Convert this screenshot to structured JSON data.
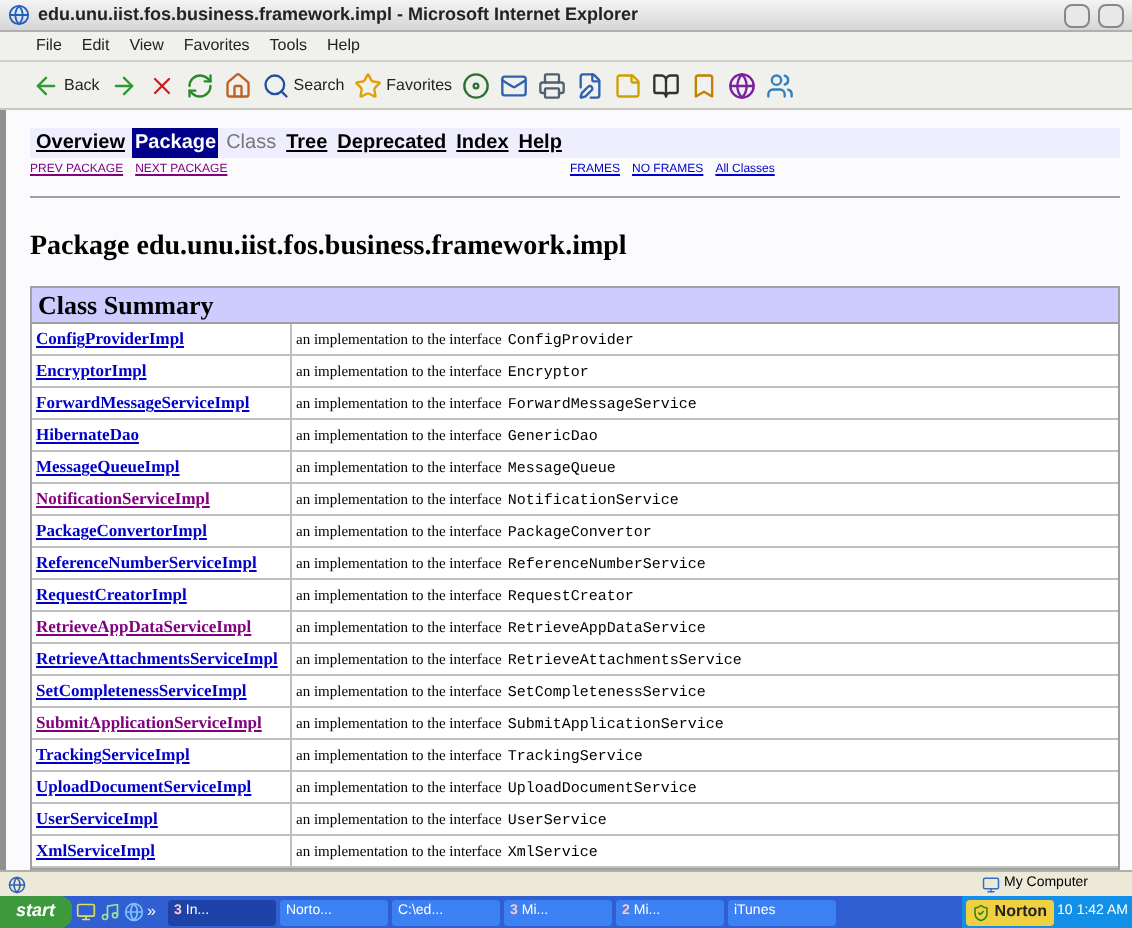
{
  "window": {
    "title": "edu.unu.iist.fos.business.framework.impl - Microsoft Internet Explorer"
  },
  "menu_bar": [
    "File",
    "Edit",
    "View",
    "Favorites",
    "Tools",
    "Help"
  ],
  "toolbar": [
    {
      "kind": "back",
      "label": "Back"
    },
    {
      "kind": "forward"
    },
    {
      "kind": "stop"
    },
    {
      "kind": "refresh"
    },
    {
      "kind": "home"
    },
    {
      "kind": "search",
      "label": "Search"
    },
    {
      "kind": "favorites",
      "label": "Favorites"
    },
    {
      "kind": "media"
    },
    {
      "kind": "mail"
    },
    {
      "kind": "print"
    },
    {
      "kind": "edit"
    },
    {
      "kind": "note"
    },
    {
      "kind": "research"
    },
    {
      "kind": "bookmark"
    },
    {
      "kind": "yahoo"
    },
    {
      "kind": "messenger"
    }
  ],
  "nav": [
    {
      "label": "Overview",
      "kind": "link",
      "selected": false
    },
    {
      "label": "Package",
      "kind": "link",
      "selected": true
    },
    {
      "label": "Class",
      "kind": "plain",
      "selected": false
    },
    {
      "label": "Tree",
      "kind": "link",
      "selected": false
    },
    {
      "label": "Deprecated",
      "kind": "link",
      "selected": false
    },
    {
      "label": "Index",
      "kind": "link",
      "selected": false
    },
    {
      "label": "Help",
      "kind": "link",
      "selected": false
    }
  ],
  "subnav_left": [
    "PREV PACKAGE",
    "NEXT PACKAGE"
  ],
  "subnav_right": [
    "FRAMES",
    "NO FRAMES",
    "All Classes"
  ],
  "heading": "Package edu.unu.iist.fos.business.framework.impl",
  "table": {
    "title": "Class Summary",
    "rows": [
      {
        "name": "ConfigProviderImpl",
        "visited": false,
        "description": "an implementation to the interface",
        "interface": "ConfigProvider"
      },
      {
        "name": "EncryptorImpl",
        "visited": false,
        "description": "an implementation to the interface",
        "interface": "Encryptor"
      },
      {
        "name": "ForwardMessageServiceImpl",
        "visited": false,
        "description": "an implementation to the interface",
        "interface": "ForwardMessageService"
      },
      {
        "name": "HibernateDao",
        "visited": false,
        "description": "an implementation to the interface",
        "interface": "GenericDao"
      },
      {
        "name": "MessageQueueImpl",
        "visited": false,
        "description": "an implementation to the interface",
        "interface": "MessageQueue"
      },
      {
        "name": "NotificationServiceImpl",
        "visited": true,
        "description": "an implementation to the interface",
        "interface": "NotificationService"
      },
      {
        "name": "PackageConvertorImpl",
        "visited": false,
        "description": "an implementation to the interface",
        "interface": "PackageConvertor"
      },
      {
        "name": "ReferenceNumberServiceImpl",
        "visited": false,
        "description": "an implementation to the interface",
        "interface": "ReferenceNumberService"
      },
      {
        "name": "RequestCreatorImpl",
        "visited": false,
        "description": "an implementation to the interface",
        "interface": "RequestCreator"
      },
      {
        "name": "RetrieveAppDataServiceImpl",
        "visited": true,
        "description": "an implementation to the interface",
        "interface": "RetrieveAppDataService"
      },
      {
        "name": "RetrieveAttachmentsServiceImpl",
        "visited": false,
        "description": "an implementation to the interface",
        "interface": "RetrieveAttachmentsService"
      },
      {
        "name": "SetCompletenessServiceImpl",
        "visited": false,
        "description": "an implementation to the interface",
        "interface": "SetCompletenessService"
      },
      {
        "name": "SubmitApplicationServiceImpl",
        "visited": true,
        "description": "an implementation to the interface",
        "interface": "SubmitApplicationService"
      },
      {
        "name": "TrackingServiceImpl",
        "visited": false,
        "description": "an implementation to the interface",
        "interface": "TrackingService"
      },
      {
        "name": "UploadDocumentServiceImpl",
        "visited": false,
        "description": "an implementation to the interface",
        "interface": "UploadDocumentService"
      },
      {
        "name": "UserServiceImpl",
        "visited": false,
        "description": "an implementation to the interface",
        "interface": "UserService"
      },
      {
        "name": "XmlServiceImpl",
        "visited": false,
        "description": "an implementation to the interface",
        "interface": "XmlService"
      }
    ]
  },
  "status_bar": {
    "zone": "My Computer"
  },
  "taskbar": {
    "start": "start",
    "chevron": "»",
    "buttons": [
      {
        "count": "3",
        "label": "In...",
        "selected": true
      },
      {
        "label": "Norto...",
        "selected": false
      },
      {
        "label": "C:\\ed...",
        "selected": false
      },
      {
        "count": "3",
        "label": "Mi...",
        "selected": false
      },
      {
        "count": "2",
        "label": "Mi...",
        "selected": false
      },
      {
        "label": "iTunes",
        "selected": false
      }
    ],
    "norton": "Norton",
    "tray_count": "10",
    "clock": "1:42 AM"
  }
}
